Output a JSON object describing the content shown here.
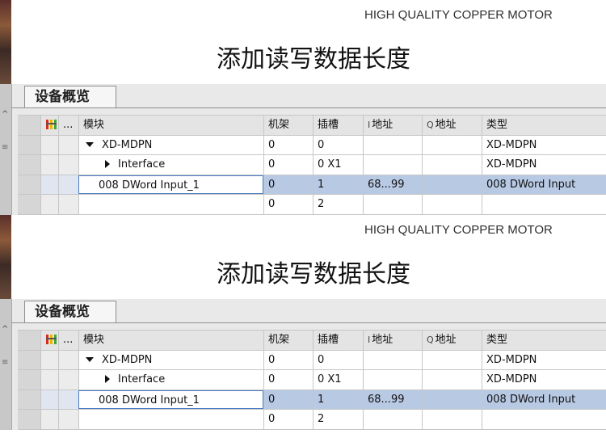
{
  "panels": [
    {
      "brand": "HIGH QUALITY COPPER MOTOR",
      "heading": "添加读写数据长度",
      "tab_label": "设备概览",
      "columns": {
        "ellipsis": "...",
        "module": "模块",
        "rack": "机架",
        "slot": "插槽",
        "i_prefix": "I",
        "i_address": "地址",
        "q_prefix": "Q",
        "q_address": "地址",
        "type": "类型"
      },
      "rows": [
        {
          "module": "XD-MDPN",
          "rack": "0",
          "slot": "0",
          "i_address": "",
          "q_address": "",
          "type": "XD-MDPN"
        },
        {
          "module": "Interface",
          "rack": "0",
          "slot": "0 X1",
          "i_address": "",
          "q_address": "",
          "type": "XD-MDPN"
        },
        {
          "module": "008 DWord Input_1",
          "rack": "0",
          "slot": "1",
          "i_address": "68...99",
          "q_address": "",
          "type": "008 DWord Input"
        },
        {
          "module": "",
          "rack": "0",
          "slot": "2",
          "i_address": "",
          "q_address": "",
          "type": ""
        }
      ]
    },
    {
      "brand": "HIGH QUALITY COPPER MOTOR",
      "heading": "添加读写数据长度",
      "tab_label": "设备概览",
      "columns": {
        "ellipsis": "...",
        "module": "模块",
        "rack": "机架",
        "slot": "插槽",
        "i_prefix": "I",
        "i_address": "地址",
        "q_prefix": "Q",
        "q_address": "地址",
        "type": "类型"
      },
      "rows": [
        {
          "module": "XD-MDPN",
          "rack": "0",
          "slot": "0",
          "i_address": "",
          "q_address": "",
          "type": "XD-MDPN"
        },
        {
          "module": "Interface",
          "rack": "0",
          "slot": "0 X1",
          "i_address": "",
          "q_address": "",
          "type": "XD-MDPN"
        },
        {
          "module": "008 DWord Input_1",
          "rack": "0",
          "slot": "1",
          "i_address": "68...99",
          "q_address": "",
          "type": "008 DWord Input"
        },
        {
          "module": "",
          "rack": "0",
          "slot": "2",
          "i_address": "",
          "q_address": "",
          "type": ""
        }
      ]
    }
  ],
  "icons": {
    "network": "network-view-icon",
    "expanded": "triangle-down-icon",
    "collapsed": "triangle-right-icon"
  },
  "colors": {
    "selection_fill": "#b8c9e4",
    "selection_border": "#4a7cc3",
    "header_bg": "#e4e4e4"
  }
}
